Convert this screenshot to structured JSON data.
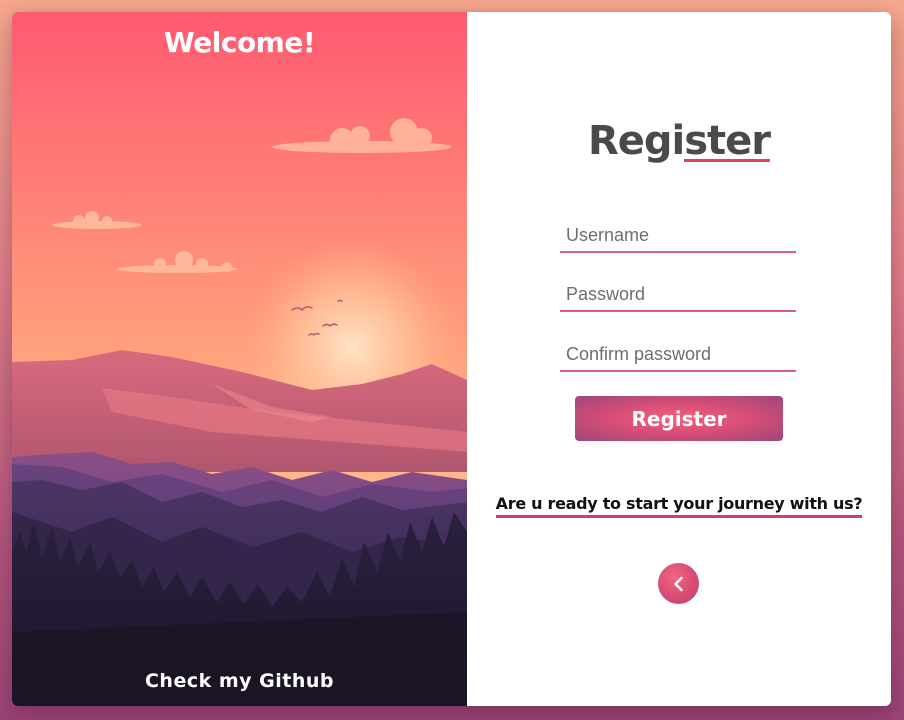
{
  "left_panel": {
    "welcome": "Welcome!",
    "github_link": "Check my Github"
  },
  "form": {
    "title": "Register",
    "username_placeholder": "Username",
    "password_placeholder": "Password",
    "confirm_placeholder": "Confirm password",
    "submit_label": "Register",
    "journey_text": "Are u ready to start your journey with us?",
    "back_icon": "chevron-left-icon"
  },
  "colors": {
    "accent": "#e0435f",
    "button_center": "#f2627c",
    "button_edge": "#9d4778",
    "title": "#4a4a4a"
  }
}
